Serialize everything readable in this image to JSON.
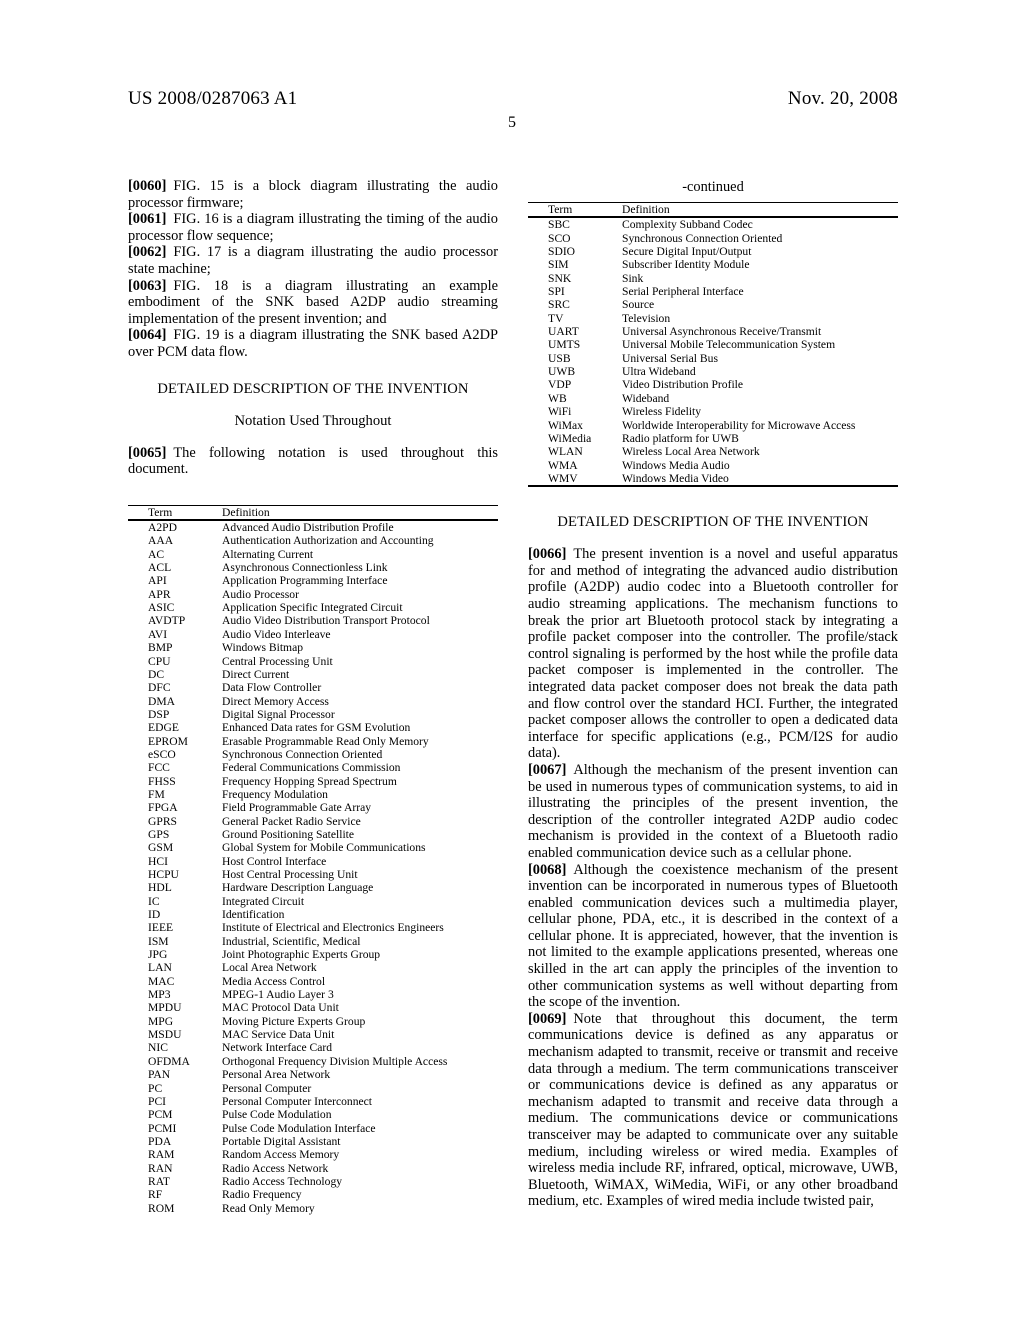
{
  "header": {
    "publication_number": "US 2008/0287063 A1",
    "publication_date": "Nov. 20, 2008",
    "page_number": "5"
  },
  "left_column": {
    "paragraphs": [
      {
        "tag": "[0060]",
        "text": "FIG. 15 is a block diagram illustrating the audio processor firmware;"
      },
      {
        "tag": "[0061]",
        "text": "FIG. 16 is a diagram illustrating the timing of the audio processor flow sequence;"
      },
      {
        "tag": "[0062]",
        "text": "FIG. 17 is a diagram illustrating the audio processor state machine;"
      },
      {
        "tag": "[0063]",
        "text": "FIG. 18 is a diagram illustrating an example embodiment of the SNK based A2DP audio streaming implementation of the present invention; and"
      },
      {
        "tag": "[0064]",
        "text": "FIG. 19 is a diagram illustrating the SNK based A2DP over PCM data flow."
      }
    ],
    "section_heading": "DETAILED DESCRIPTION OF THE INVENTION",
    "sub_heading": "Notation Used Throughout",
    "notation_paragraph": {
      "tag": "[0065]",
      "text": "The following notation is used throughout this document."
    },
    "table": {
      "columns": [
        "Term",
        "Definition"
      ],
      "rows": [
        [
          "A2PD",
          "Advanced Audio Distribution Profile"
        ],
        [
          "AAA",
          "Authentication Authorization and Accounting"
        ],
        [
          "AC",
          "Alternating Current"
        ],
        [
          "ACL",
          "Asynchronous Connectionless Link"
        ],
        [
          "API",
          "Application Programming Interface"
        ],
        [
          "APR",
          "Audio Processor"
        ],
        [
          "ASIC",
          "Application Specific Integrated Circuit"
        ],
        [
          "AVDTP",
          "Audio Video Distribution Transport Protocol"
        ],
        [
          "AVI",
          "Audio Video Interleave"
        ],
        [
          "BMP",
          "Windows Bitmap"
        ],
        [
          "CPU",
          "Central Processing Unit"
        ],
        [
          "DC",
          "Direct Current"
        ],
        [
          "DFC",
          "Data Flow Controller"
        ],
        [
          "DMA",
          "Direct Memory Access"
        ],
        [
          "DSP",
          "Digital Signal Processor"
        ],
        [
          "EDGE",
          "Enhanced Data rates for GSM Evolution"
        ],
        [
          "EPROM",
          "Erasable Programmable Read Only Memory"
        ],
        [
          "eSCO",
          "Synchronous Connection Oriented"
        ],
        [
          "FCC",
          "Federal Communications Commission"
        ],
        [
          "FHSS",
          "Frequency Hopping Spread Spectrum"
        ],
        [
          "FM",
          "Frequency Modulation"
        ],
        [
          "FPGA",
          "Field Programmable Gate Array"
        ],
        [
          "GPRS",
          "General Packet Radio Service"
        ],
        [
          "GPS",
          "Ground Positioning Satellite"
        ],
        [
          "GSM",
          "Global System for Mobile Communications"
        ],
        [
          "HCI",
          "Host Control Interface"
        ],
        [
          "HCPU",
          "Host Central Processing Unit"
        ],
        [
          "HDL",
          "Hardware Description Language"
        ],
        [
          "IC",
          "Integrated Circuit"
        ],
        [
          "ID",
          "Identification"
        ],
        [
          "IEEE",
          "Institute of Electrical and Electronics Engineers"
        ],
        [
          "ISM",
          "Industrial, Scientific, Medical"
        ],
        [
          "JPG",
          "Joint Photographic Experts Group"
        ],
        [
          "LAN",
          "Local Area Network"
        ],
        [
          "MAC",
          "Media Access Control"
        ],
        [
          "MP3",
          "MPEG-1 Audio Layer 3"
        ],
        [
          "MPDU",
          "MAC Protocol Data Unit"
        ],
        [
          "MPG",
          "Moving Picture Experts Group"
        ],
        [
          "MSDU",
          "MAC Service Data Unit"
        ],
        [
          "NIC",
          "Network Interface Card"
        ],
        [
          "OFDMA",
          "Orthogonal Frequency Division Multiple Access"
        ],
        [
          "PAN",
          "Personal Area Network"
        ],
        [
          "PC",
          "Personal Computer"
        ],
        [
          "PCI",
          "Personal Computer Interconnect"
        ],
        [
          "PCM",
          "Pulse Code Modulation"
        ],
        [
          "PCMI",
          "Pulse Code Modulation Interface"
        ],
        [
          "PDA",
          "Portable Digital Assistant"
        ],
        [
          "RAM",
          "Random Access Memory"
        ],
        [
          "RAN",
          "Radio Access Network"
        ],
        [
          "RAT",
          "Radio Access Technology"
        ],
        [
          "RF",
          "Radio Frequency"
        ],
        [
          "ROM",
          "Read Only Memory"
        ]
      ]
    }
  },
  "right_column": {
    "table": {
      "continued_label": "-continued",
      "columns": [
        "Term",
        "Definition"
      ],
      "rows": [
        [
          "SBC",
          "Complexity Subband Codec"
        ],
        [
          "SCO",
          "Synchronous Connection Oriented"
        ],
        [
          "SDIO",
          "Secure Digital Input/Output"
        ],
        [
          "SIM",
          "Subscriber Identity Module"
        ],
        [
          "SNK",
          "Sink"
        ],
        [
          "SPI",
          "Serial Peripheral Interface"
        ],
        [
          "SRC",
          "Source"
        ],
        [
          "TV",
          "Television"
        ],
        [
          "UART",
          "Universal Asynchronous Receive/Transmit"
        ],
        [
          "UMTS",
          "Universal Mobile Telecommunication System"
        ],
        [
          "USB",
          "Universal Serial Bus"
        ],
        [
          "UWB",
          "Ultra Wideband"
        ],
        [
          "VDP",
          "Video Distribution Profile"
        ],
        [
          "WB",
          "Wideband"
        ],
        [
          "WiFi",
          "Wireless Fidelity"
        ],
        [
          "WiMax",
          "Worldwide Interoperability for Microwave Access"
        ],
        [
          "WiMedia",
          "Radio platform for UWB"
        ],
        [
          "WLAN",
          "Wireless Local Area Network"
        ],
        [
          "WMA",
          "Windows Media Audio"
        ],
        [
          "WMV",
          "Windows Media Video"
        ]
      ]
    },
    "section_heading": "DETAILED DESCRIPTION OF THE INVENTION",
    "paragraphs": [
      {
        "tag": "[0066]",
        "text": "The present invention is a novel and useful apparatus for and method of integrating the advanced audio distribution profile (A2DP) audio codec into a Bluetooth controller for audio streaming applications. The mechanism functions to break the prior art Bluetooth protocol stack by integrating a profile packet composer into the controller. The profile/stack control signaling is performed by the host while the profile data packet composer is implemented in the controller. The integrated data packet composer does not break the data path and flow control over the standard HCI. Further, the integrated packet composer allows the controller to open a dedicated data interface for specific applications (e.g., PCM/I2S for audio data)."
      },
      {
        "tag": "[0067]",
        "text": "Although the mechanism of the present invention can be used in numerous types of communication systems, to aid in illustrating the principles of the present invention, the description of the controller integrated A2DP audio codec mechanism is provided in the context of a Bluetooth radio enabled communication device such as a cellular phone."
      },
      {
        "tag": "[0068]",
        "text": "Although the coexistence mechanism of the present invention can be incorporated in numerous types of Bluetooth enabled communication devices such a multimedia player, cellular phone, PDA, etc., it is described in the context of a cellular phone. It is appreciated, however, that the invention is not limited to the example applications presented, whereas one skilled in the art can apply the principles of the invention to other communication systems as well without departing from the scope of the invention."
      },
      {
        "tag": "[0069]",
        "text": "Note that throughout this document, the term communications device is defined as any apparatus or mechanism adapted to transmit, receive or transmit and receive data through a medium. The term communications transceiver or communications device is defined as any apparatus or mechanism adapted to transmit and receive data through a medium. The communications device or communications transceiver may be adapted to communicate over any suitable medium, including wireless or wired media. Examples of wireless media include RF, infrared, optical, microwave, UWB, Bluetooth, WiMAX, WiMedia, WiFi, or any other broadband medium, etc. Examples of wired media include twisted pair,"
      }
    ]
  }
}
